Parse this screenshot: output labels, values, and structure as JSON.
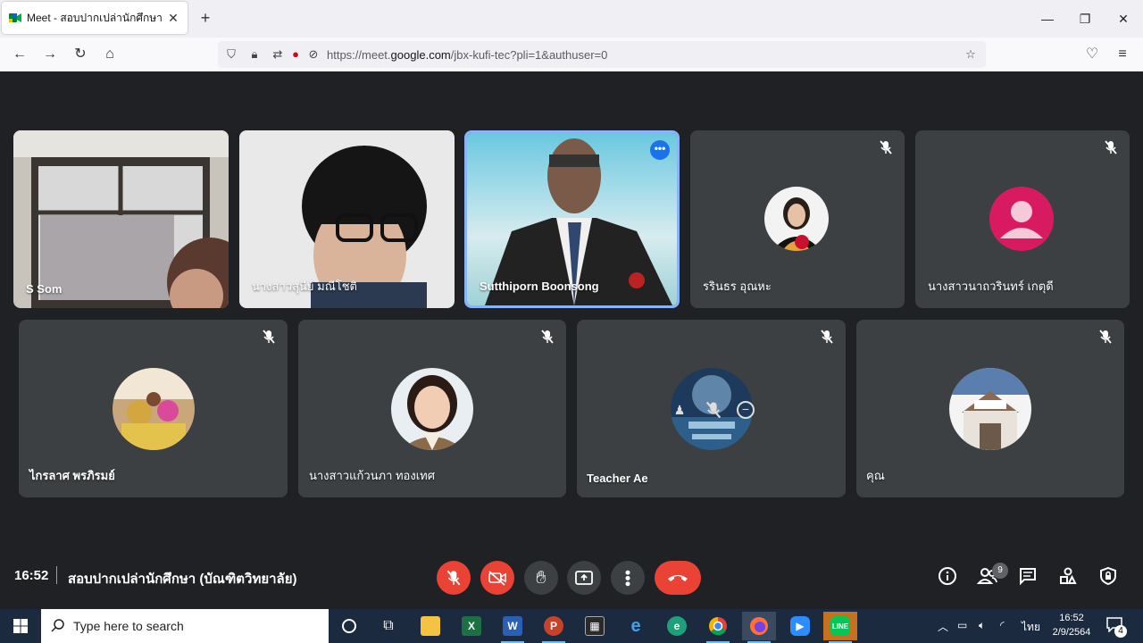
{
  "browser": {
    "tab_title": "Meet - สอบปากเปล่านักศึกษา (บัณ",
    "url_prefix": "https://meet.",
    "url_host": "google.com",
    "url_path": "/jbx-kufi-tec?pli=1&authuser=0"
  },
  "participants_row1": [
    {
      "name": "S Som",
      "kind": "video"
    },
    {
      "name": "นางสาวสุนีย์ มณีโชติ",
      "kind": "video"
    },
    {
      "name": "Sutthiporn Boonsong",
      "kind": "video",
      "active": true
    },
    {
      "name": "รรินธร อุณหะ",
      "kind": "avatar",
      "muted": true
    },
    {
      "name": "นางสาวนาถวรินทร์ เกตุดี",
      "kind": "avatar-letter",
      "muted": true
    }
  ],
  "participants_row2": [
    {
      "name": "ไกรลาศ พรภิรมย์",
      "muted": true
    },
    {
      "name": "นางสาวแก้วนภา ทองเทศ",
      "muted": true
    },
    {
      "name": "Teacher Ae",
      "muted": true
    },
    {
      "name": "คุณ",
      "muted": true
    }
  ],
  "meeting": {
    "time": "16:52",
    "title": "สอบปากเปล่านักศึกษา (บัณฑิตวิทยาลัย)",
    "participant_count": "9"
  },
  "colors": {
    "accent_red": "#ea4335",
    "tile_bg": "#3c4043",
    "page_bg": "#202124",
    "active_border": "#8ab4f8",
    "pink_avatar": "#d81b60"
  },
  "taskbar": {
    "search_placeholder": "Type here to search",
    "lang": "ไทย",
    "time": "16:52",
    "date": "2/9/2564",
    "notif_count": "4"
  }
}
